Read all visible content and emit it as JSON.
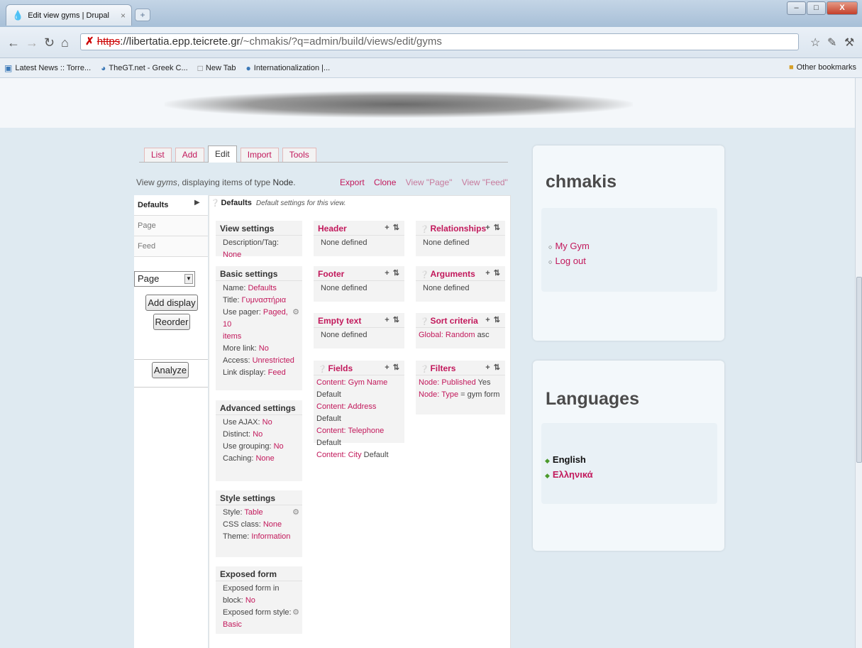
{
  "browser": {
    "tab_title": "Edit view gyms | Drupal",
    "tab_close": "×",
    "new_tab": "+",
    "window_buttons": [
      "–",
      "□",
      "X"
    ],
    "url_lock": "✗",
    "url_protocol": "https",
    "url_host": "://libertatia.epp.teicrete.gr",
    "url_path": "/~chmakis/?q=admin/build/views/edit/gyms",
    "bookmarks": [
      "Latest News :: Torre...",
      "TheGT.net - Greek C...",
      "New Tab",
      "Internationalization |..."
    ],
    "other_bookmarks": "Other bookmarks"
  },
  "tabs": [
    "List",
    "Add",
    "Edit",
    "Import",
    "Tools"
  ],
  "view_info": {
    "prefix": "View ",
    "name": "gyms",
    "middle": ", displaying items of type ",
    "type": "Node",
    "suffix": "."
  },
  "actions": [
    "Export",
    "Clone",
    "View \"Page\"",
    "View \"Feed\""
  ],
  "displays": [
    "Defaults",
    "Page",
    "Feed"
  ],
  "display_select": "Page",
  "buttons": {
    "add_display": "Add display",
    "reorder": "Reorder",
    "analyze": "Analyze"
  },
  "pane": {
    "title": "Defaults",
    "subtitle": "Default settings for this view."
  },
  "col1": {
    "view_settings": {
      "title": "View settings",
      "label": "Description/Tag:",
      "value": "None"
    },
    "basic_settings": {
      "title": "Basic settings",
      "name_label": "Name:",
      "name_value": "Defaults",
      "title_label": "Title:",
      "title_value": "Γυμναστήρια",
      "pager_label": "Use pager:",
      "pager_value": "Paged, 10",
      "pager_value2": "items",
      "more_label": "More link:",
      "more_value": "No",
      "access_label": "Access:",
      "access_value": "Unrestricted",
      "link_label": "Link display:",
      "link_value": "Feed"
    },
    "advanced_settings": {
      "title": "Advanced settings",
      "ajax_label": "Use AJAX:",
      "ajax_value": "No",
      "distinct_label": "Distinct:",
      "distinct_value": "No",
      "grouping_label": "Use grouping:",
      "grouping_value": "No",
      "caching_label": "Caching:",
      "caching_value": "None"
    },
    "style_settings": {
      "title": "Style settings",
      "style_label": "Style:",
      "style_value": "Table",
      "css_label": "CSS class:",
      "css_value": "None",
      "theme_label": "Theme:",
      "theme_value": "Information"
    },
    "exposed_form": {
      "title": "Exposed form",
      "block_label": "Exposed form in block:",
      "block_value": "No",
      "style_label": "Exposed form style:",
      "style_value": "Basic"
    }
  },
  "col2": {
    "header": {
      "title": "Header",
      "value": "None defined"
    },
    "footer": {
      "title": "Footer",
      "value": "None defined"
    },
    "empty_text": {
      "title": "Empty text",
      "value": "None defined"
    },
    "fields": {
      "title": "Fields",
      "items": [
        {
          "link": "Content: Gym Name",
          "suffix": "Default"
        },
        {
          "link": "Content: Address",
          "suffix": "Default"
        },
        {
          "link": "Content: Telephone",
          "suffix": "Default"
        },
        {
          "link": "Content: City",
          "suffix": "Default"
        }
      ]
    }
  },
  "col3": {
    "relationships": {
      "title": "Relationships",
      "value": "None defined"
    },
    "arguments": {
      "title": "Arguments",
      "value": "None defined"
    },
    "sort_criteria": {
      "title": "Sort criteria",
      "link": "Global: Random",
      "suffix": "asc"
    },
    "filters": {
      "title": "Filters",
      "items": [
        {
          "link": "Node: Published",
          "suffix": "Yes"
        },
        {
          "link": "Node: Type",
          "suffix": "= gym form"
        }
      ]
    }
  },
  "box_ops": "+ ⇅",
  "sidebar": {
    "user_title": "chmakis",
    "user_links": [
      "My Gym",
      "Log out"
    ],
    "languages_title": "Languages",
    "languages": [
      "English",
      "Ελληνικά"
    ]
  }
}
